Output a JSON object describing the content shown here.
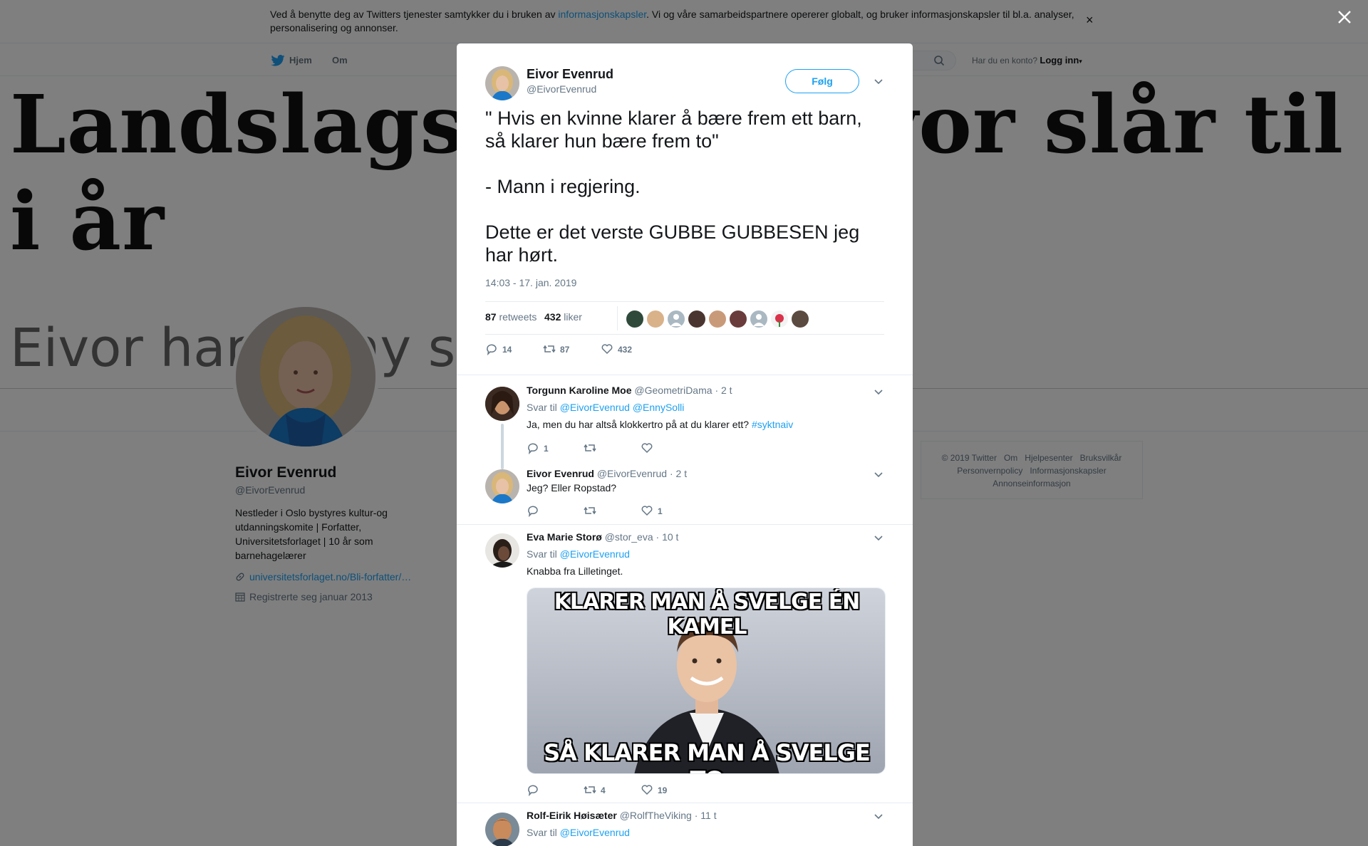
{
  "cookie": {
    "text_before": "Ved å benytte deg av Twitters tjenester samtykker du i bruken av ",
    "link": "informasjonskapsler",
    "text_after": ". Vi og våre samarbeidspartnere opererer globalt, og bruker informasjonskapsler til bl.a. analyser, personalisering og annonser.",
    "close": "×"
  },
  "nav": {
    "home": "Hjem",
    "about": "Om",
    "account_prompt": "Har du en konto?",
    "login": "Logg inn"
  },
  "banner": {
    "headline": "Landslagstrener Eivor slår til i år",
    "subline": "Eivor har en ny sesong. Ho får"
  },
  "profile": {
    "name": "Eivor Evenrud",
    "handle": "@EivorEvenrud",
    "bio": "Nestleder i Oslo bystyres kultur-og utdanningskomite | Forfatter, Universitetsforlaget | 10 år som barnehagelærer",
    "link": "universitetsforlaget.no/Bli-forfatter/…",
    "joined": "Registrerte seg januar 2013"
  },
  "footer": {
    "links": [
      "© 2019 Twitter",
      "Om",
      "Hjelpesenter",
      "Bruksvilkår",
      "Personvernpolicy",
      "Informasjonskapsler",
      "Annonseinformasjon"
    ]
  },
  "tweet": {
    "name": "Eivor Evenrud",
    "handle": "@EivorEvenrud",
    "follow": "Følg",
    "text": "\" Hvis en kvinne klarer å bære frem ett barn, så klarer hun bære frem to\"\n\n- Mann i regjering.\n\nDette er det verste GUBBE GUBBESEN jeg har hørt.",
    "time": "14:03 - 17. jan. 2019",
    "retweets_count": "87",
    "retweets_label": "retweets",
    "likes_count": "432",
    "likes_label": "liker",
    "actions": {
      "replies": "14",
      "retweets": "87",
      "likes": "432"
    }
  },
  "replies": [
    {
      "name": "Torgunn Karoline Moe",
      "handle": "@GeometriDama",
      "time": "· 2 t",
      "replying_label": "Svar til",
      "mentions": "@EivorEvenrud @EnnySolli",
      "text": "Ja, men du har altså klokkertro på at du klarer ett?",
      "hashtag": "#syktnaiv",
      "counts": {
        "replies": "1",
        "retweets": "",
        "likes": ""
      }
    },
    {
      "name": "Eivor Evenrud",
      "handle": "@EivorEvenrud",
      "time": "· 2 t",
      "text": "Jeg? Eller Ropstad?",
      "counts": {
        "replies": "",
        "retweets": "",
        "likes": "1"
      }
    },
    {
      "name": "Eva Marie Storø",
      "handle": "@stor_eva",
      "time": "· 10 t",
      "replying_label": "Svar til",
      "mentions": "@EivorEvenrud",
      "text": "Knabba fra Lilletinget.",
      "meme_top": "KLARER MAN Å SVELGE ÉN KAMEL",
      "meme_bottom": "SÅ KLARER MAN Å SVELGE TO",
      "counts": {
        "replies": "",
        "retweets": "4",
        "likes": "19"
      }
    },
    {
      "name": "Rolf-Eirik Høisæter",
      "handle": "@RolfTheViking",
      "time": "· 11 t",
      "replying_label": "Svar til",
      "mentions": "@EivorEvenrud"
    }
  ],
  "colors": {
    "accent": "#1da1f2",
    "text": "#14171a",
    "secondary": "#657786",
    "overlay": "rgba(0,0,0,0.5)"
  }
}
